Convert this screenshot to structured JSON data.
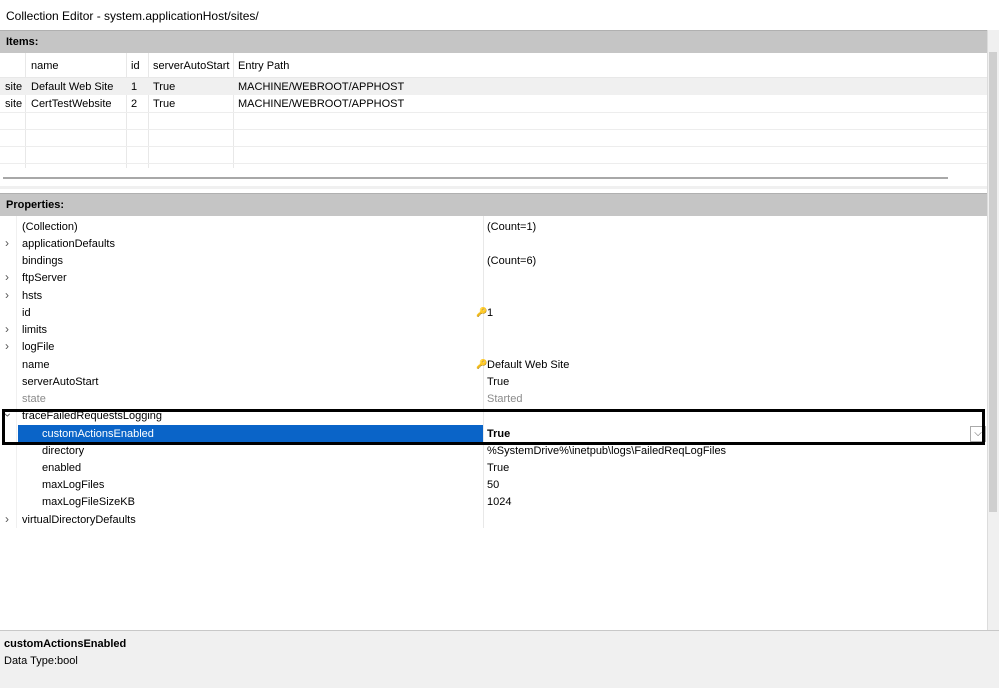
{
  "window": {
    "title": "Collection Editor - system.applicationHost/sites/"
  },
  "items": {
    "header": "Items:",
    "columns": [
      "name",
      "id",
      "serverAutoStart",
      "Entry Path"
    ],
    "rows": [
      {
        "type": "site",
        "name": "Default Web Site",
        "id": "1",
        "serverAutoStart": "True",
        "entry_path": "MACHINE/WEBROOT/APPHOST"
      },
      {
        "type": "site",
        "name": "CertTestWebsite",
        "id": "2",
        "serverAutoStart": "True",
        "entry_path": "MACHINE/WEBROOT/APPHOST"
      }
    ]
  },
  "properties": {
    "header": "Properties:",
    "rows": [
      {
        "name": "(Collection)",
        "value": "(Count=1)"
      },
      {
        "name": "applicationDefaults",
        "value": ""
      },
      {
        "name": "bindings",
        "value": "(Count=6)"
      },
      {
        "name": "ftpServer",
        "value": ""
      },
      {
        "name": "hsts",
        "value": ""
      },
      {
        "name": "id",
        "value": "1"
      },
      {
        "name": "limits",
        "value": ""
      },
      {
        "name": "logFile",
        "value": ""
      },
      {
        "name": "name",
        "value": "Default Web Site"
      },
      {
        "name": "serverAutoStart",
        "value": "True"
      },
      {
        "name": "state",
        "value": "Started"
      },
      {
        "name": "traceFailedRequestsLogging",
        "value": ""
      },
      {
        "name": "customActionsEnabled",
        "value": "True"
      },
      {
        "name": "directory",
        "value": "%SystemDrive%\\inetpub\\logs\\FailedReqLogFiles"
      },
      {
        "name": "enabled",
        "value": "True"
      },
      {
        "name": "maxLogFiles",
        "value": "50"
      },
      {
        "name": "maxLogFileSizeKB",
        "value": "1024"
      },
      {
        "name": "virtualDirectoryDefaults",
        "value": ""
      }
    ]
  },
  "description": {
    "title": "customActionsEnabled",
    "type": "Data Type:bool"
  },
  "icons": {
    "expand": "chevron-right-icon",
    "collapse": "chevron-down-icon",
    "key": "key-icon",
    "dropdown": "dropdown-arrow-icon"
  },
  "colors": {
    "selection": "#0a64c8",
    "header_bg": "#c5c5c5"
  }
}
